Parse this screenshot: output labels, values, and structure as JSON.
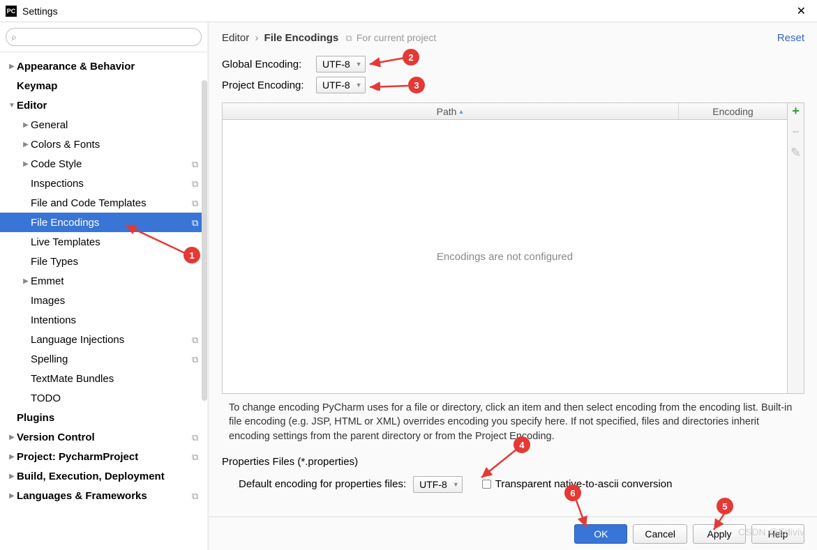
{
  "window": {
    "title": "Settings"
  },
  "breadcrumb": {
    "parent": "Editor",
    "current": "File Encodings",
    "scope": "For current project"
  },
  "reset": "Reset",
  "form": {
    "global_label": "Global Encoding:",
    "global_value": "UTF-8",
    "project_label": "Project Encoding:",
    "project_value": "UTF-8"
  },
  "table": {
    "col_path": "Path",
    "col_encoding": "Encoding",
    "empty": "Encodings are not configured"
  },
  "help": "To change encoding PyCharm uses for a file or directory, click an item and then select encoding from the encoding list. Built-in file encoding (e.g. JSP, HTML or XML) overrides encoding you specify here. If not specified, files and directories inherit encoding settings from the parent directory or from the Project Encoding.",
  "props": {
    "section": "Properties Files (*.properties)",
    "default_label": "Default encoding for properties files:",
    "default_value": "UTF-8",
    "checkbox_label": "Transparent native-to-ascii conversion"
  },
  "buttons": {
    "ok": "OK",
    "cancel": "Cancel",
    "apply": "Apply",
    "help": "Help"
  },
  "tree": [
    {
      "label": "Appearance & Behavior",
      "bold": true,
      "caret": "▶",
      "indent": 0
    },
    {
      "label": "Keymap",
      "bold": true,
      "caret": "",
      "indent": 0
    },
    {
      "label": "Editor",
      "bold": true,
      "caret": "▼",
      "indent": 0
    },
    {
      "label": "General",
      "caret": "▶",
      "indent": 1
    },
    {
      "label": "Colors & Fonts",
      "caret": "▶",
      "indent": 1
    },
    {
      "label": "Code Style",
      "caret": "▶",
      "indent": 1,
      "badge": true
    },
    {
      "label": "Inspections",
      "caret": "",
      "indent": 1,
      "badge": true
    },
    {
      "label": "File and Code Templates",
      "caret": "",
      "indent": 1,
      "badge": true
    },
    {
      "label": "File Encodings",
      "caret": "",
      "indent": 1,
      "badge": true,
      "selected": true
    },
    {
      "label": "Live Templates",
      "caret": "",
      "indent": 1
    },
    {
      "label": "File Types",
      "caret": "",
      "indent": 1
    },
    {
      "label": "Emmet",
      "caret": "▶",
      "indent": 1
    },
    {
      "label": "Images",
      "caret": "",
      "indent": 1
    },
    {
      "label": "Intentions",
      "caret": "",
      "indent": 1
    },
    {
      "label": "Language Injections",
      "caret": "",
      "indent": 1,
      "badge": true
    },
    {
      "label": "Spelling",
      "caret": "",
      "indent": 1,
      "badge": true
    },
    {
      "label": "TextMate Bundles",
      "caret": "",
      "indent": 1
    },
    {
      "label": "TODO",
      "caret": "",
      "indent": 1
    },
    {
      "label": "Plugins",
      "bold": true,
      "caret": "",
      "indent": 0
    },
    {
      "label": "Version Control",
      "bold": true,
      "caret": "▶",
      "indent": 0,
      "badge": true
    },
    {
      "label": "Project: PycharmProject",
      "bold": true,
      "caret": "▶",
      "indent": 0,
      "badge": true
    },
    {
      "label": "Build, Execution, Deployment",
      "bold": true,
      "caret": "▶",
      "indent": 0
    },
    {
      "label": "Languages & Frameworks",
      "bold": true,
      "caret": "▶",
      "indent": 0,
      "badge": true
    }
  ],
  "annotations": {
    "1": "1",
    "2": "2",
    "3": "3",
    "4": "4",
    "5": "5",
    "6": "6"
  },
  "watermark": "CSDN @Ediviv"
}
